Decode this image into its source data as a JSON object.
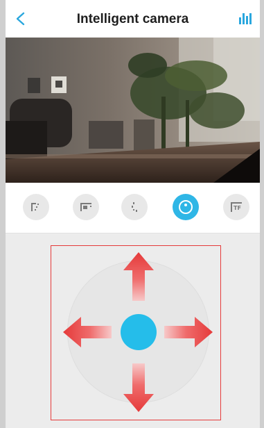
{
  "header": {
    "title": "Intelligent camera"
  },
  "icons": {
    "back": "back-chevron-icon",
    "signal": "signal-bars-icon"
  },
  "toolbar": {
    "tools": [
      {
        "icon": "rotate-icon",
        "active": false
      },
      {
        "icon": "screen-mode-icon",
        "active": false
      },
      {
        "icon": "flip-icon",
        "active": false
      },
      {
        "icon": "ptz-control-icon",
        "active": true
      },
      {
        "icon": "tf-card-icon",
        "active": false,
        "label": "TF"
      }
    ]
  },
  "colors": {
    "accent": "#2fb6e6",
    "arrow": "#e53a3a",
    "ptz_box_border": "#e53a3a",
    "joystick_center": "#25bdea"
  }
}
